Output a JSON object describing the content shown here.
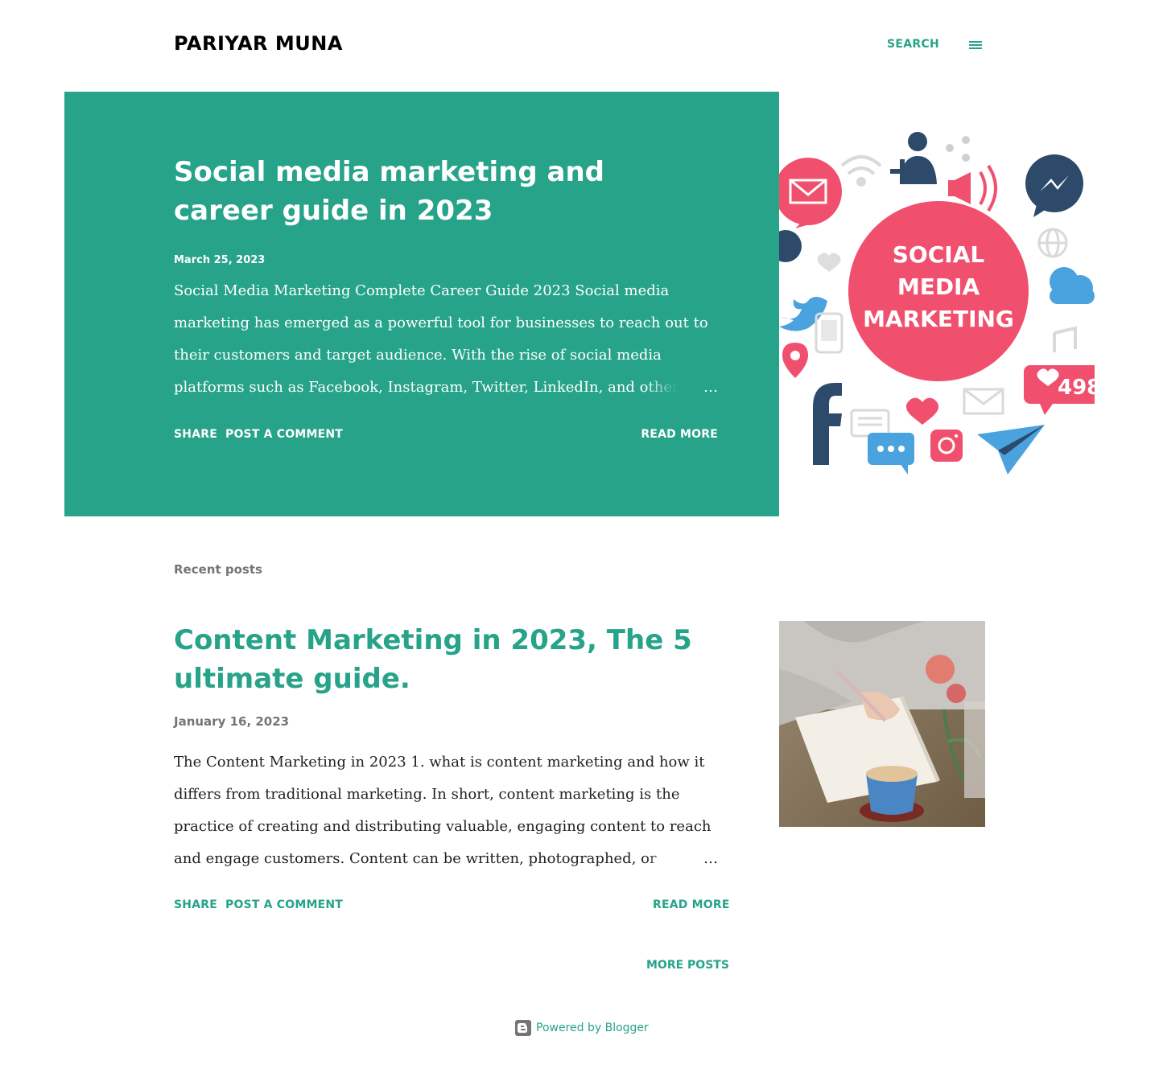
{
  "header": {
    "blog_title": "PARIYAR MUNA",
    "search_label": "SEARCH",
    "menu_icon": "hamburger-menu-icon"
  },
  "featured_post": {
    "title": "Social media marketing and career guide in 2023",
    "date": "March 25, 2023",
    "snippet": " Social Media Marketing Complete Career Guide 2023   Social media marketing has emerged as a powerful tool for businesses to reach out to their customers and target audience. With the rise of social media platforms such as Facebook, Instagram, Twitter, LinkedIn, and others,",
    "ellipsis": "…",
    "share_label": "Share",
    "comment_label": "Post a Comment",
    "read_more_label": "Read more",
    "image": {
      "center_text_lines": [
        "SOCIAL",
        "MEDIA",
        "MARKETING"
      ],
      "badge_count": "498",
      "colors": {
        "pink": "#f0506e",
        "blue": "#4aa3df",
        "navy": "#2d4a6b"
      }
    }
  },
  "recent_label": "Recent posts",
  "posts": [
    {
      "title": "Content Marketing in 2023, The 5 ultimate guide.",
      "date": "January 16, 2023",
      "snippet": "The Content Marketing in 2023     1. what is content marketing and how it differs from traditional marketing.    In short, content marketing is the practice of creating and distributing valuable, engaging content to reach and engage customers. Content can be written, photographed, or",
      "ellipsis": "…",
      "share_label": "Share",
      "comment_label": "Post a Comment",
      "read_more_label": "Read more"
    }
  ],
  "more_posts_label": "More posts",
  "footer": {
    "powered_by": "Powered by Blogger",
    "icon": "blogger-icon"
  },
  "colors": {
    "accent": "#26a389",
    "muted": "#757575",
    "text": "#212121"
  }
}
